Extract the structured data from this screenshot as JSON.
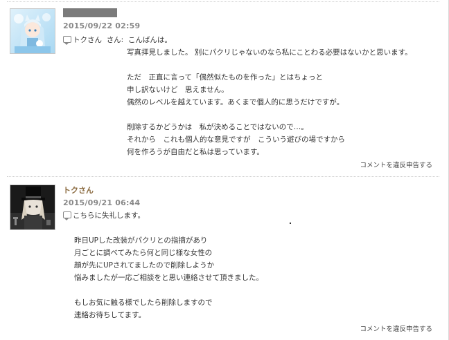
{
  "comments": [
    {
      "author": "",
      "date": "2015/09/22 02:59",
      "reply_to": "トクさん",
      "reply_suffix": "さん:",
      "lines": [
        "こんばんは。",
        "写真拝見しました。 別にパクリじゃないのなら私にことわる必要はないかと思います。",
        "",
        "ただ　正直に言って「偶然似たものを作った」とはちょっと",
        "申し訳ないけど　思えません。",
        "偶然のレベルを越えています。あくまで個人的に思うだけですが。",
        "",
        "削除するかどうかは　私が決めることではないので…。",
        "それから　これも個人的な意見ですが　こういう遊びの場ですから",
        "何を作ろうが自由だと私は思っています。"
      ],
      "report_label": "コメントを違反申告する"
    },
    {
      "author": "トクさん",
      "date": "2015/09/21 06:44",
      "lines": [
        "こちらに失礼します。",
        "",
        "昨日UPした改装がパクリとの指摘があり",
        "月ごとに調べてみたら何と同じ様な女性の",
        "顔が先にUPされてましたので削除しようか",
        "悩みましたが一応ご相談をと思い連絡させて頂きました。",
        "",
        "もしお気に触る様でしたら削除しますので",
        "連絡お待ちしてます。"
      ],
      "report_label": "コメントを違反申告する"
    }
  ]
}
